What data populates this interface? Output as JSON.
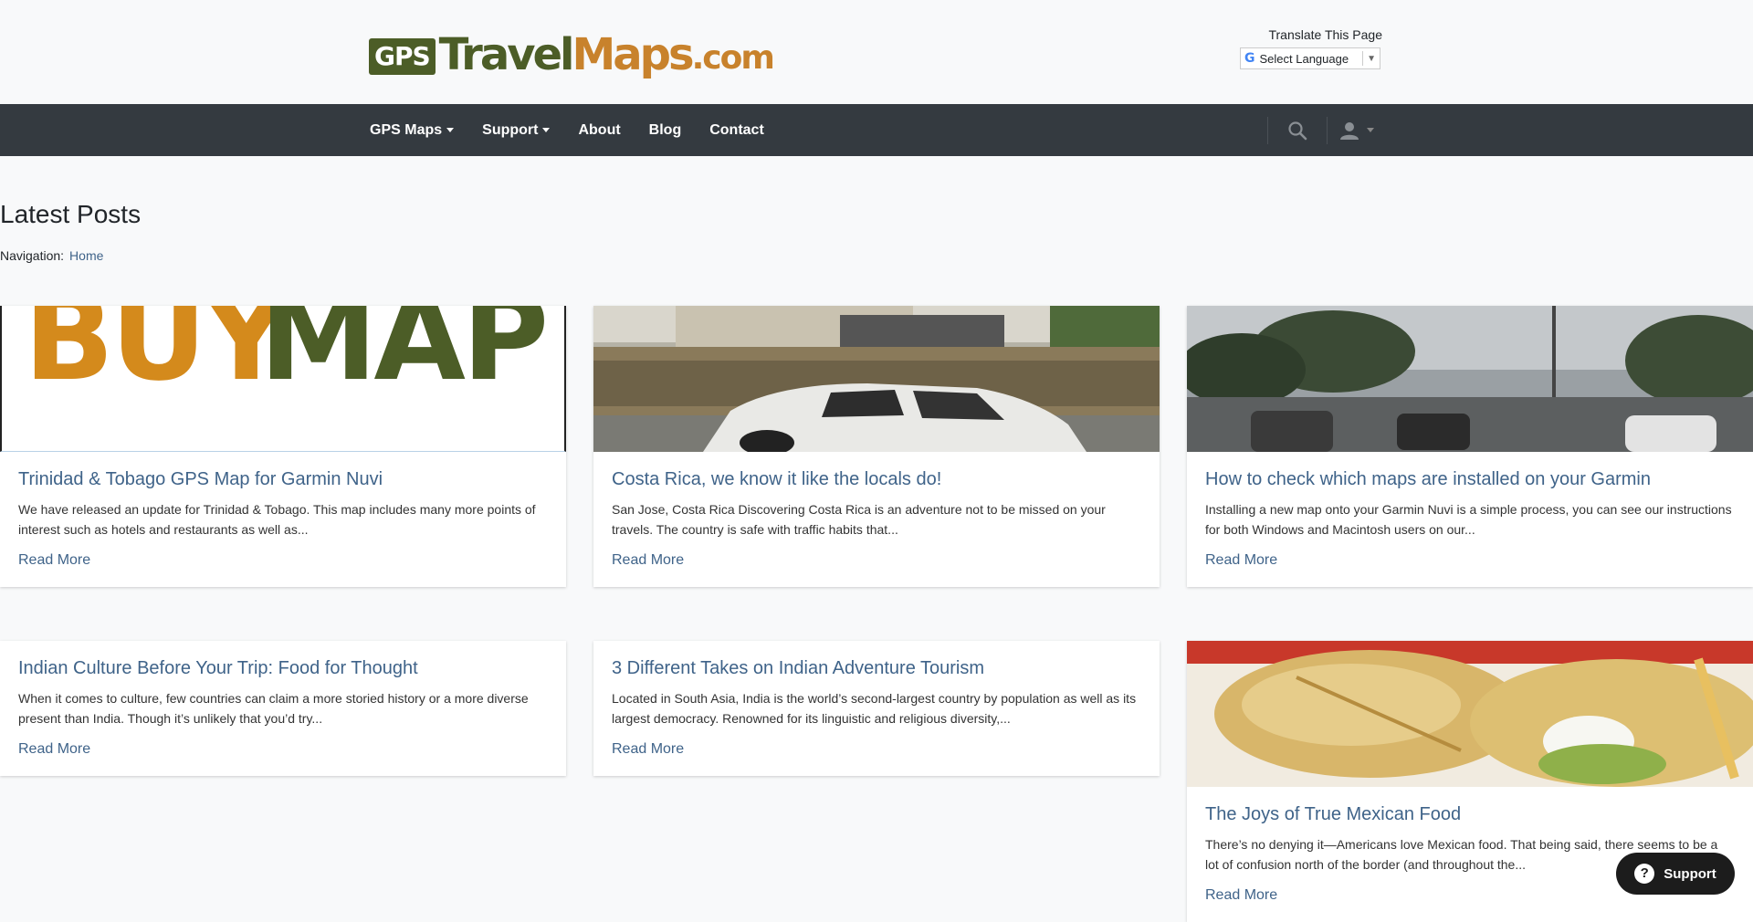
{
  "header": {
    "logo": {
      "gps": "GPS",
      "travel": "Travel",
      "maps": "Maps",
      "com": ".com"
    },
    "translate_label": "Translate This Page",
    "select_language": "Select Language",
    "select_arrow": "▼"
  },
  "nav": {
    "items": [
      {
        "label": "GPS Maps",
        "dropdown": true
      },
      {
        "label": "Support",
        "dropdown": true
      },
      {
        "label": "About",
        "dropdown": false
      },
      {
        "label": "Blog",
        "dropdown": false
      },
      {
        "label": "Contact",
        "dropdown": false
      }
    ],
    "icons": [
      "search-icon",
      "user-icon"
    ]
  },
  "main": {
    "title": "Latest Posts",
    "breadcrumb_label": "Navigation:",
    "breadcrumb_home": "Home",
    "read_more": "Read More",
    "posts": [
      {
        "title": "Trinidad & Tobago GPS Map for Garmin Nuvi",
        "excerpt": "We have released an update for Trinidad & Tobago.  This map includes many more points of interest such as hotels and restaurants as well as...",
        "image": "buy-map"
      },
      {
        "title": "Costa Rica, we know it like the locals do!",
        "excerpt": "San Jose, Costa Rica Discovering Costa Rica is an adventure not to be missed on your travels.  The country is safe with traffic habits that...",
        "image": "street-car"
      },
      {
        "title": "How to check which maps are installed on your Garmin",
        "excerpt": "Installing a new map onto your Garmin Nuvi is a simple process, you can see our instructions for both Windows and Macintosh users on our...",
        "image": "street-traffic"
      },
      {
        "title": "Indian Culture Before Your Trip: Food for Thought",
        "excerpt": "When it comes to culture, few countries can claim a more storied history or a more diverse present than India. Though it’s unlikely that you’d try...",
        "image": null
      },
      {
        "title": "3 Different Takes on Indian Adventure Tourism",
        "excerpt": "Located in South Asia, India is the world’s second-largest country by population as well as its largest democracy.  Renowned for its linguistic and religious diversity,...",
        "image": null
      },
      {
        "title": "The Joys of True Mexican Food",
        "excerpt": "There’s no denying it—Americans love Mexican food.  That being said, there seems to be a lot of confusion north of the border (and throughout the...",
        "image": "tamales"
      }
    ],
    "buy_map": {
      "buy": "BUY",
      "map": "MAP"
    }
  },
  "support_widget": {
    "icon": "?",
    "label": "Support"
  },
  "colors": {
    "nav_bg": "#343a40",
    "link": "#3f6389",
    "logo_green": "#4c5d27",
    "logo_orange": "#c8822c"
  }
}
